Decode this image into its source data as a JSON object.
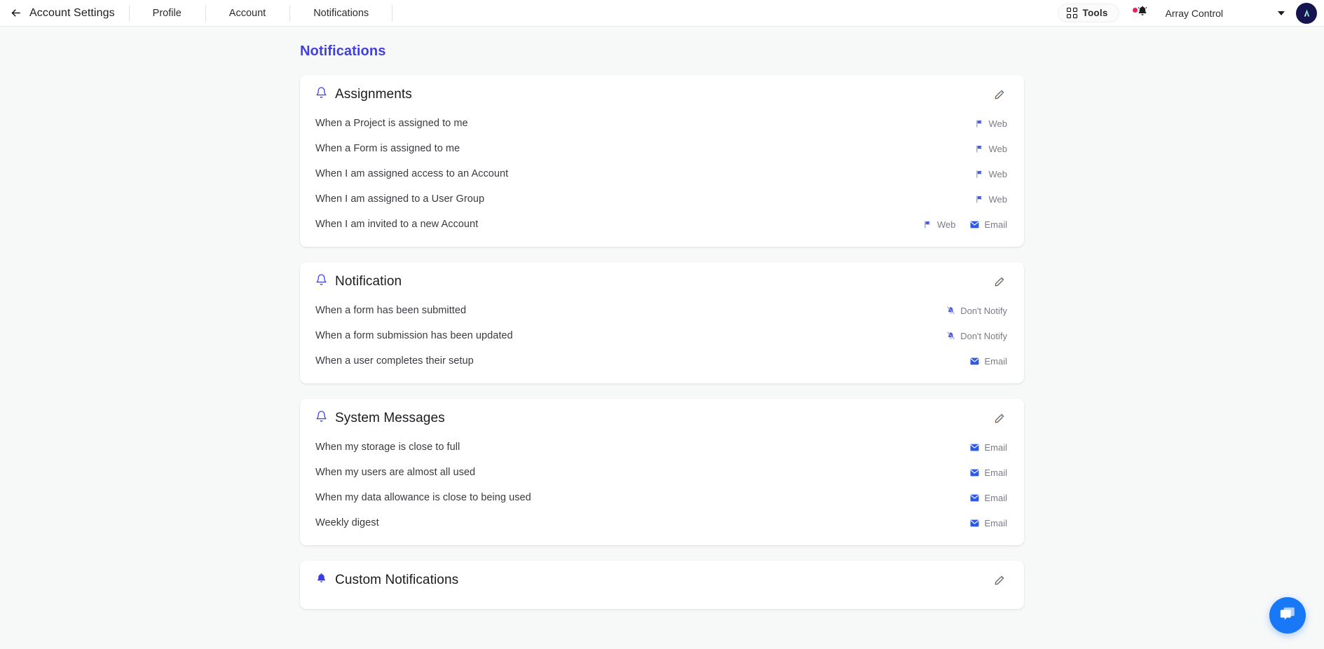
{
  "topbar": {
    "back_label": "Account Settings",
    "back_icon": "arrow-left-icon",
    "tabs": [
      {
        "label": "Profile"
      },
      {
        "label": "Account"
      },
      {
        "label": "Notifications"
      }
    ],
    "tools_label": "Tools",
    "tools_icon": "grid-apps-icon",
    "bell_icon": "bell-icon",
    "bell_has_badge": true,
    "org_name": "Array Control",
    "caret_icon": "chevron-down-icon",
    "avatar_letter": "A"
  },
  "main": {
    "page_title": "Notifications",
    "edit_icon": "pencil-icon",
    "cards": [
      {
        "title": "Assignments",
        "icon": "bell-outline-icon",
        "rows": [
          {
            "label": "When a Project is assigned to me",
            "badges": [
              {
                "text": "Web",
                "icon": "flag-icon"
              }
            ]
          },
          {
            "label": "When a Form is assigned to me",
            "badges": [
              {
                "text": "Web",
                "icon": "flag-icon"
              }
            ]
          },
          {
            "label": "When I am assigned access to an Account",
            "badges": [
              {
                "text": "Web",
                "icon": "flag-icon"
              }
            ]
          },
          {
            "label": "When I am assigned to a User Group",
            "badges": [
              {
                "text": "Web",
                "icon": "flag-icon"
              }
            ]
          },
          {
            "label": "When I am invited to a new Account",
            "badges": [
              {
                "text": "Web",
                "icon": "flag-icon"
              },
              {
                "text": "Email",
                "icon": "envelope-icon"
              }
            ]
          }
        ]
      },
      {
        "title": "Notification",
        "icon": "bell-outline-icon",
        "rows": [
          {
            "label": "When a form has been submitted",
            "badges": [
              {
                "text": "Don't Notify",
                "icon": "bell-slash-icon"
              }
            ]
          },
          {
            "label": "When a form submission has been updated",
            "badges": [
              {
                "text": "Don't Notify",
                "icon": "bell-slash-icon"
              }
            ]
          },
          {
            "label": "When a user completes their setup",
            "badges": [
              {
                "text": "Email",
                "icon": "envelope-icon"
              }
            ]
          }
        ]
      },
      {
        "title": "System Messages",
        "icon": "bell-outline-icon",
        "rows": [
          {
            "label": "When my storage is close to full",
            "badges": [
              {
                "text": "Email",
                "icon": "envelope-icon"
              }
            ]
          },
          {
            "label": "When my users are almost all used",
            "badges": [
              {
                "text": "Email",
                "icon": "envelope-icon"
              }
            ]
          },
          {
            "label": "When my data allowance is close to being used",
            "badges": [
              {
                "text": "Email",
                "icon": "envelope-icon"
              }
            ]
          },
          {
            "label": "Weekly digest",
            "badges": [
              {
                "text": "Email",
                "icon": "envelope-icon"
              }
            ]
          }
        ]
      },
      {
        "title": "Custom Notifications",
        "icon": "bell-filled-icon",
        "rows": []
      }
    ]
  },
  "chat": {
    "icon": "chat-bubble-icon"
  },
  "colors": {
    "accent": "#4340e0",
    "badge_blue": "#3b4de0",
    "page_bg": "#f7f8f8",
    "card_bg": "#ffffff",
    "chat_blue": "#1878f5",
    "avatar_bg": "#161450",
    "bell_dot": "#e91e63"
  }
}
